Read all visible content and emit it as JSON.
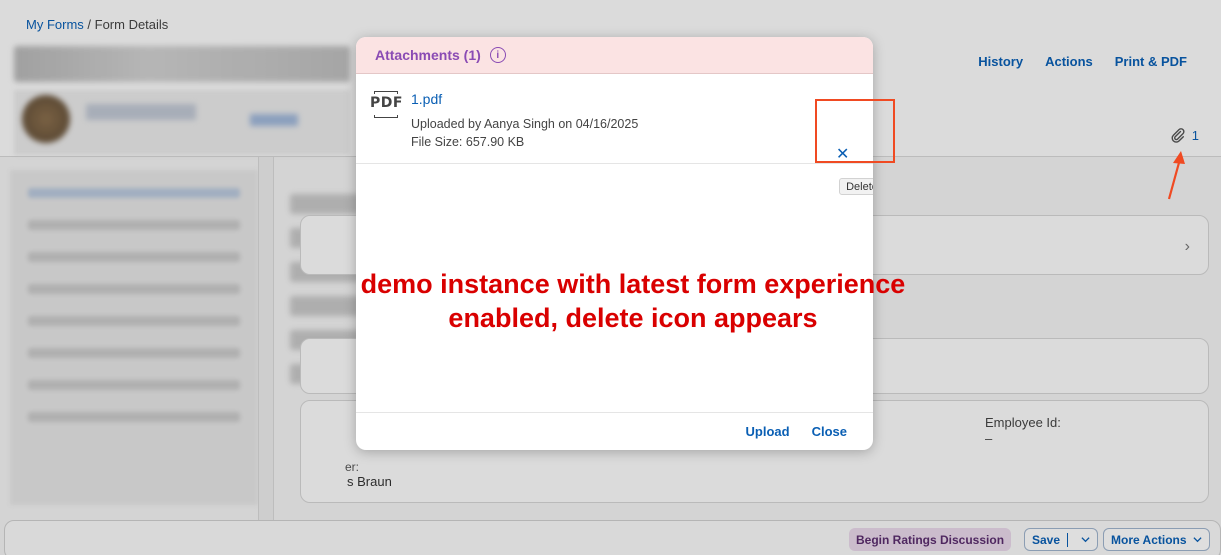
{
  "breadcrumb": {
    "parent": "My Forms",
    "separator": " / ",
    "current": "Form Details"
  },
  "top_actions": {
    "history": "History",
    "actions": "Actions",
    "print_pdf": "Print & PDF"
  },
  "attachment_indicator": {
    "count": "1",
    "icon": "paperclip-icon"
  },
  "employee": {
    "id_label": "Employee Id:",
    "id_value": "–",
    "manager_label_partial": "er:",
    "manager_value_partial": "s Braun"
  },
  "footer": {
    "ratings": "Begin Ratings Discussion",
    "save": "Save",
    "more_actions": "More Actions"
  },
  "dialog": {
    "title": "Attachments (1)",
    "items": [
      {
        "file_name": "1.pdf",
        "uploaded": "Uploaded by Aanya Singh on 04/16/2025",
        "size": "File Size: 657.90 KB",
        "icon": "pdf-icon"
      }
    ],
    "delete_tooltip": "Delete",
    "upload": "Upload",
    "close": "Close"
  },
  "annotation": {
    "line1": "demo instance with latest form experience",
    "line2": "enabled, delete icon appears",
    "color": "#d90000"
  },
  "colors": {
    "accent": "#0a5fb4",
    "dialog_header": "#fbe3e3",
    "title": "#8a4bb4",
    "highlight": "#f04a22"
  }
}
